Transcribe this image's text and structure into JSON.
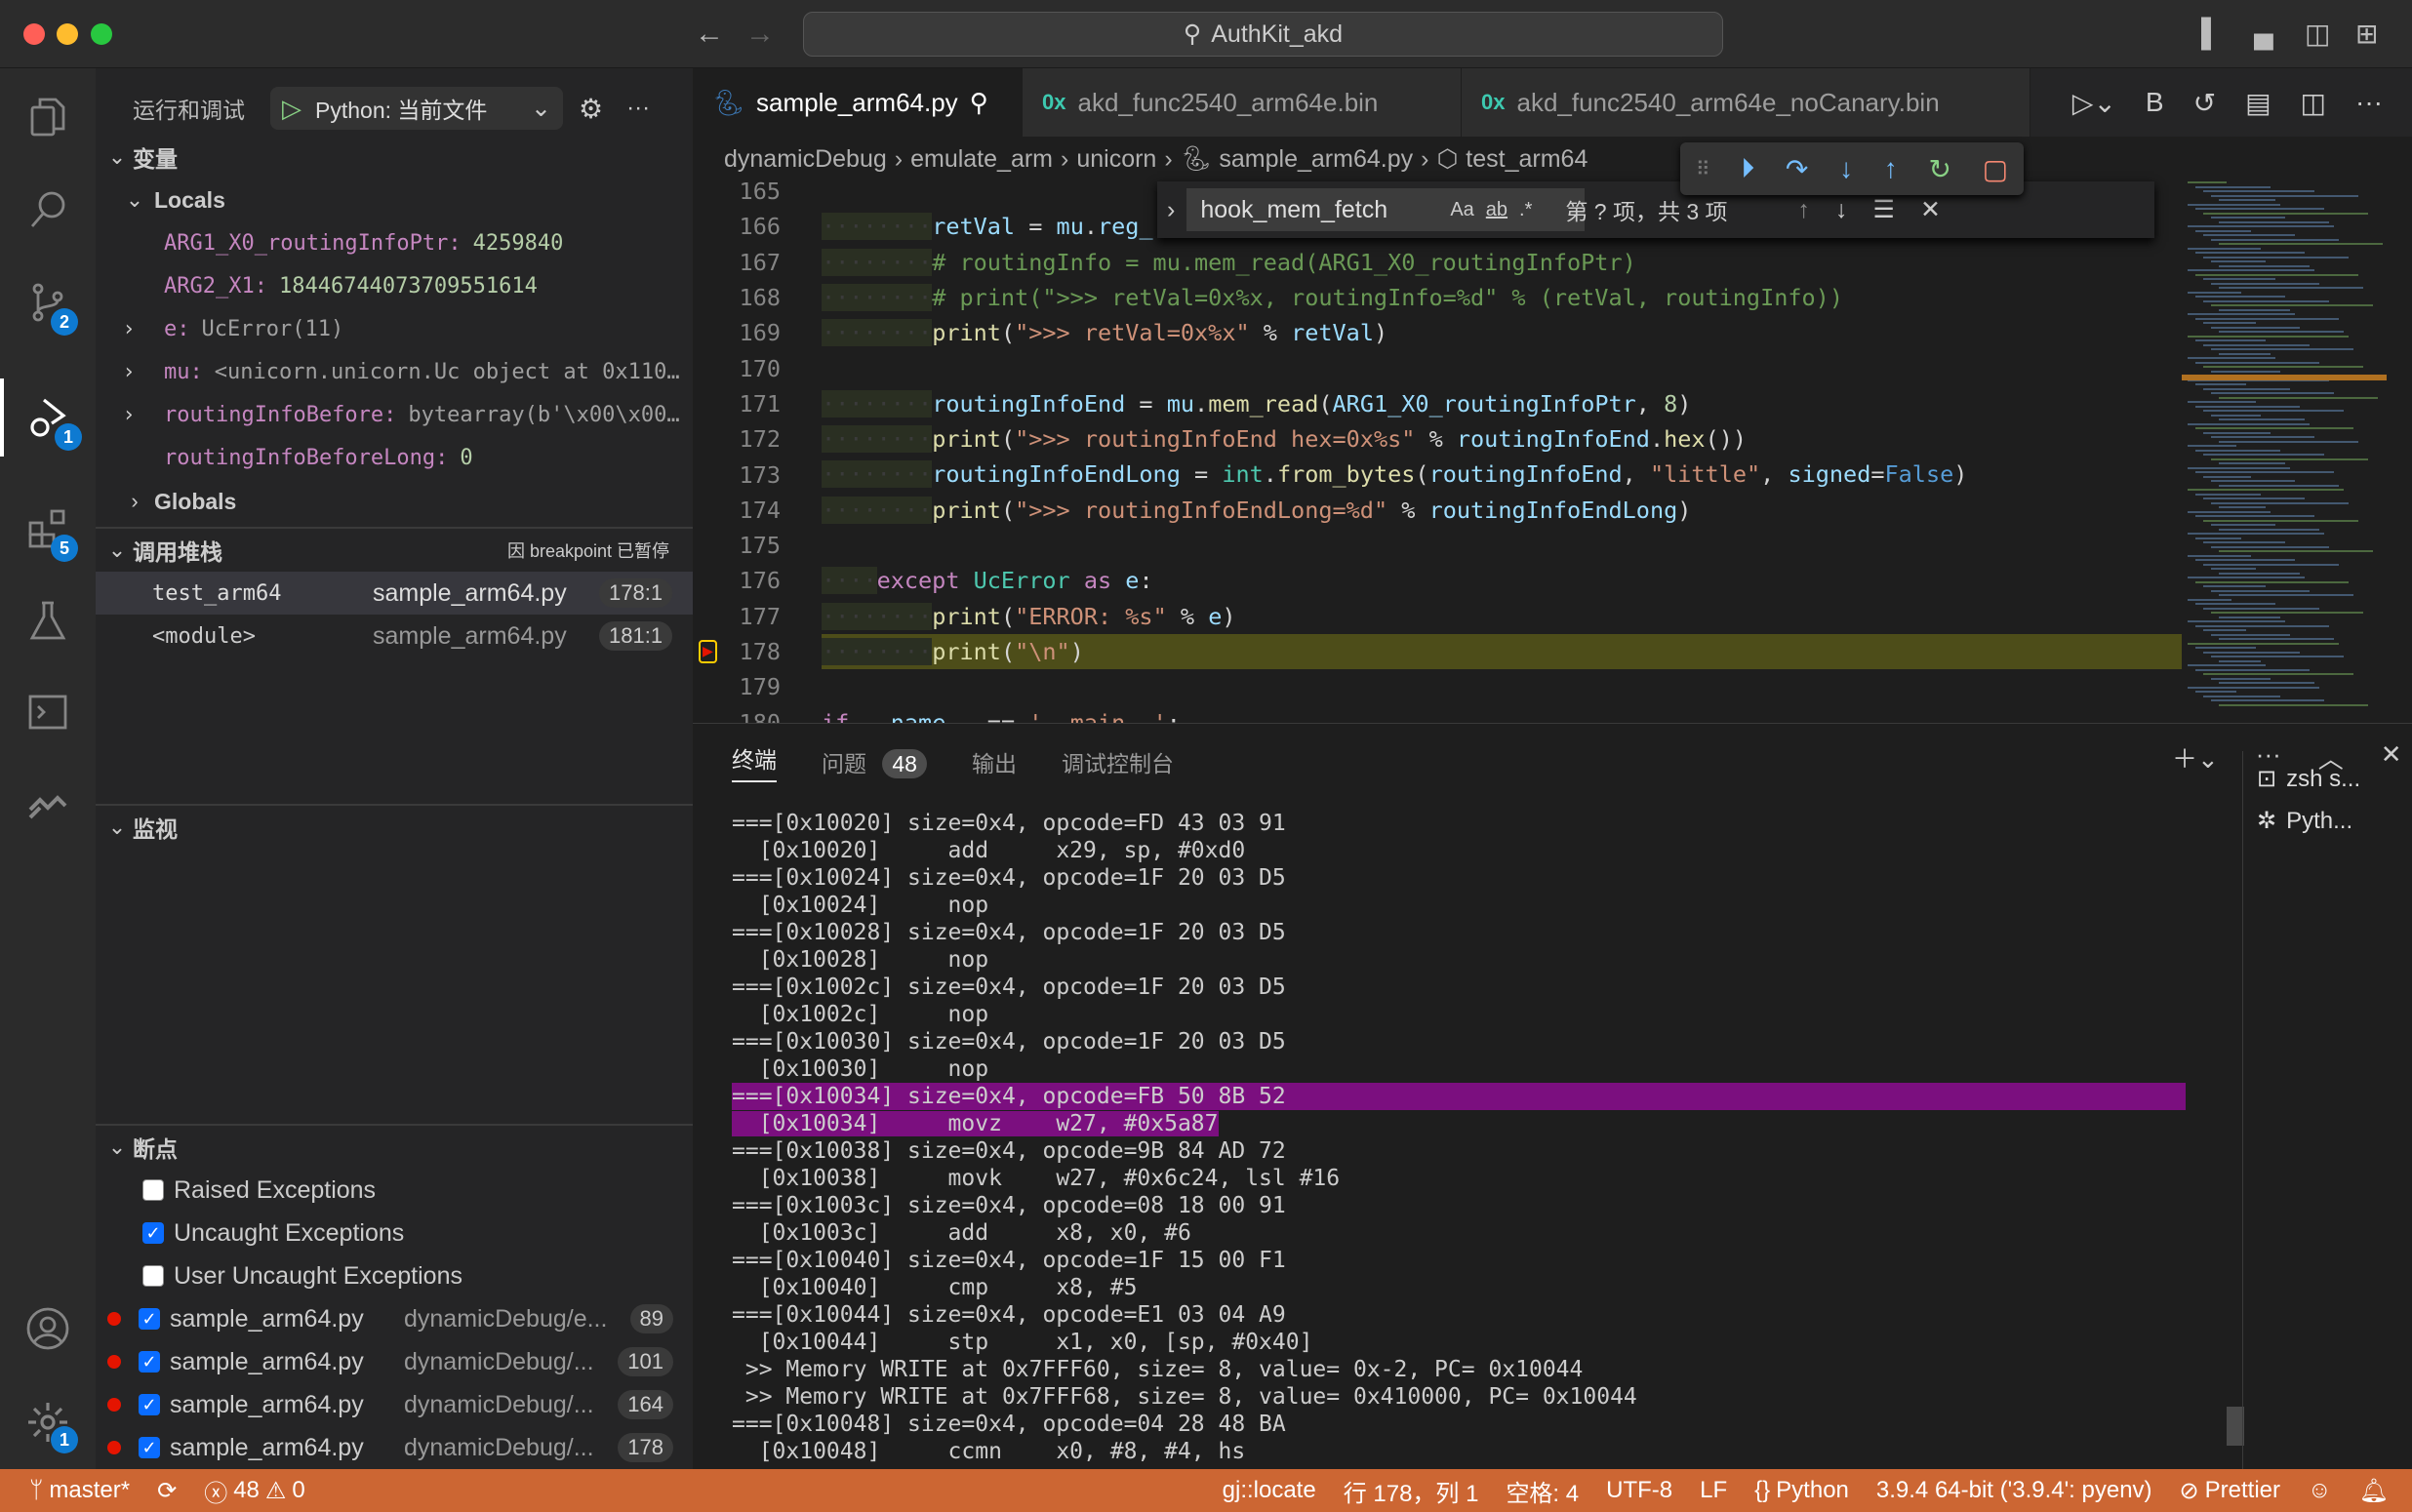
{
  "window": {
    "title": "AuthKit_akd",
    "traffic": [
      "#ff5f57",
      "#febc2e",
      "#28c840"
    ]
  },
  "activity": {
    "badges": {
      "scm": "2",
      "debug": "1",
      "extensions": "5",
      "settings": "1"
    }
  },
  "sidebar": {
    "title": "运行和调试",
    "config": "Python: 当前文件",
    "variables": {
      "title": "变量",
      "locals": "Locals",
      "globals": "Globals",
      "items": [
        {
          "name": "ARG1_X0_routingInfoPtr:",
          "value": "4259840",
          "expandable": false,
          "kind": "val"
        },
        {
          "name": "ARG2_X1:",
          "value": "18446744073709551614",
          "expandable": false,
          "kind": "val"
        },
        {
          "name": "e:",
          "value": "UcError(11)",
          "expandable": true,
          "kind": "obj"
        },
        {
          "name": "mu:",
          "value": "<unicorn.unicorn.Uc object at 0x110…",
          "expandable": true,
          "kind": "obj"
        },
        {
          "name": "routingInfoBefore:",
          "value": "bytearray(b'\\x00\\x00…",
          "expandable": true,
          "kind": "obj"
        },
        {
          "name": "routingInfoBeforeLong:",
          "value": "0",
          "expandable": false,
          "kind": "val"
        }
      ]
    },
    "callstack": {
      "title": "调用堆栈",
      "status": "因 breakpoint 已暂停",
      "frames": [
        {
          "name": "test_arm64",
          "file": "sample_arm64.py",
          "pos": "178:1"
        },
        {
          "name": "<module>",
          "file": "sample_arm64.py",
          "pos": "181:1"
        }
      ]
    },
    "watch": {
      "title": "监视"
    },
    "breakpoints": {
      "title": "断点",
      "exceptions": [
        {
          "label": "Raised Exceptions",
          "checked": false
        },
        {
          "label": "Uncaught Exceptions",
          "checked": true
        },
        {
          "label": "User Uncaught Exceptions",
          "checked": false
        }
      ],
      "items": [
        {
          "file": "sample_arm64.py",
          "path": "dynamicDebug/e...",
          "line": "89"
        },
        {
          "file": "sample_arm64.py",
          "path": "dynamicDebug/...",
          "line": "101"
        },
        {
          "file": "sample_arm64.py",
          "path": "dynamicDebug/...",
          "line": "164"
        },
        {
          "file": "sample_arm64.py",
          "path": "dynamicDebug/...",
          "line": "178"
        }
      ]
    }
  },
  "tabs": [
    {
      "label": "sample_arm64.py",
      "active": true,
      "icon": "python-icon"
    },
    {
      "label": "akd_func2540_arm64e.bin",
      "icon": "hex-icon"
    },
    {
      "label": "akd_func2540_arm64e_noCanary.bin",
      "icon": "hex-icon"
    }
  ],
  "breadcrumb": [
    "dynamicDebug",
    "emulate_arm",
    "unicorn",
    "sample_arm64.py",
    "test_arm64"
  ],
  "find": {
    "value": "hook_mem_fetch",
    "aa": "Aa",
    "ab": "ab",
    "re": ".*",
    "result": "第 ? 项，共 3 项"
  },
  "editor": {
    "current_line": 178,
    "lines": [
      {
        "n": 165,
        "t": ""
      },
      {
        "n": 166,
        "t": "        retVal = mu.reg_"
      },
      {
        "n": 167,
        "t": "        # routingInfo = mu.mem_read(ARG1_X0_routingInfoPtr)"
      },
      {
        "n": 168,
        "t": "        # print(\">>> retVal=0x%x, routingInfo=%d\" % (retVal, routingInfo))"
      },
      {
        "n": 169,
        "t": "        print(\">>> retVal=0x%x\" % retVal)"
      },
      {
        "n": 170,
        "t": ""
      },
      {
        "n": 171,
        "t": "        routingInfoEnd = mu.mem_read(ARG1_X0_routingInfoPtr, 8)"
      },
      {
        "n": 172,
        "t": "        print(\">>> routingInfoEnd hex=0x%s\" % routingInfoEnd.hex())"
      },
      {
        "n": 173,
        "t": "        routingInfoEndLong = int.from_bytes(routingInfoEnd, \"little\", signed=False)"
      },
      {
        "n": 174,
        "t": "        print(\">>> routingInfoEndLong=%d\" % routingInfoEndLong)"
      },
      {
        "n": 175,
        "t": ""
      },
      {
        "n": 176,
        "t": "    except UcError as e:"
      },
      {
        "n": 177,
        "t": "        print(\"ERROR: %s\" % e)"
      },
      {
        "n": 178,
        "t": "        print(\"\\n\")"
      },
      {
        "n": 179,
        "t": ""
      },
      {
        "n": 180,
        "t": "if __name__ == '__main__':"
      }
    ]
  },
  "panel": {
    "tabs": [
      "终端",
      "问题",
      "输出",
      "调试控制台"
    ],
    "problems_count": "48",
    "terminals": [
      "zsh s...",
      "Pyth..."
    ],
    "selected_lines": [
      12,
      13
    ],
    "lines": [
      "===[0x10020] size=0x4, opcode=FD 43 03 91",
      "  [0x10020]     add     x29, sp, #0xd0",
      "===[0x10024] size=0x4, opcode=1F 20 03 D5",
      "  [0x10024]     nop",
      "===[0x10028] size=0x4, opcode=1F 20 03 D5",
      "  [0x10028]     nop",
      "===[0x1002c] size=0x4, opcode=1F 20 03 D5",
      "  [0x1002c]     nop",
      "===[0x10030] size=0x4, opcode=1F 20 03 D5",
      "  [0x10030]     nop",
      "===[0x10034] size=0x4, opcode=FB 50 8B 52",
      "  [0x10034]     movz    w27, #0x5a87",
      "===[0x10038] size=0x4, opcode=9B 84 AD 72",
      "  [0x10038]     movk    w27, #0x6c24, lsl #16",
      "===[0x1003c] size=0x4, opcode=08 18 00 91",
      "  [0x1003c]     add     x8, x0, #6",
      "===[0x10040] size=0x4, opcode=1F 15 00 F1",
      "  [0x10040]     cmp     x8, #5",
      "===[0x10044] size=0x4, opcode=E1 03 04 A9",
      "  [0x10044]     stp     x1, x0, [sp, #0x40]",
      " >> Memory WRITE at 0x7FFF60, size= 8, value= 0x-2, PC= 0x10044",
      " >> Memory WRITE at 0x7FFF68, size= 8, value= 0x410000, PC= 0x10044",
      "===[0x10048] size=0x4, opcode=04 28 48 BA",
      "  [0x10048]     ccmn    x0, #8, #4, hs"
    ]
  },
  "status": {
    "branch": "master*",
    "errors": "48",
    "warnings": "0",
    "locate": "gj::locate",
    "position": "行 178，列 1",
    "spaces": "空格: 4",
    "encoding": "UTF-8",
    "eol": "LF",
    "language": "Python",
    "interpreter": "3.9.4 64-bit ('3.9.4': pyenv)",
    "prettier": "Prettier",
    "color": "#cc6633"
  }
}
